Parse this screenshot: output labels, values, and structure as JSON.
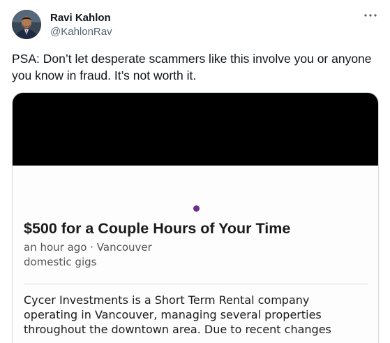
{
  "author": {
    "display_name": "Ravi Kahlon",
    "handle": "@KahlonRav",
    "avatar_icon": "profile-photo",
    "more_icon": "more-horizontal-icon"
  },
  "tweet": {
    "text": "PSA: Don’t let desperate scammers like this involve you or anyone you know in fraud. It’s not worth it."
  },
  "media": {
    "ad_title": "$500 for a Couple Hours of Your Time",
    "ad_meta": "an hour ago · Vancouver",
    "ad_category": "domestic gigs",
    "ad_body_lines": [
      "Cycer Investments is a Short Term Rental company",
      "operating in Vancouver, managing several properties",
      "throughout the downtown area. Due to recent changes"
    ]
  },
  "colors": {
    "accent_dot": "#6e2c92",
    "text_primary": "#0f1419",
    "text_secondary": "#536471",
    "border": "#cfd9de"
  }
}
